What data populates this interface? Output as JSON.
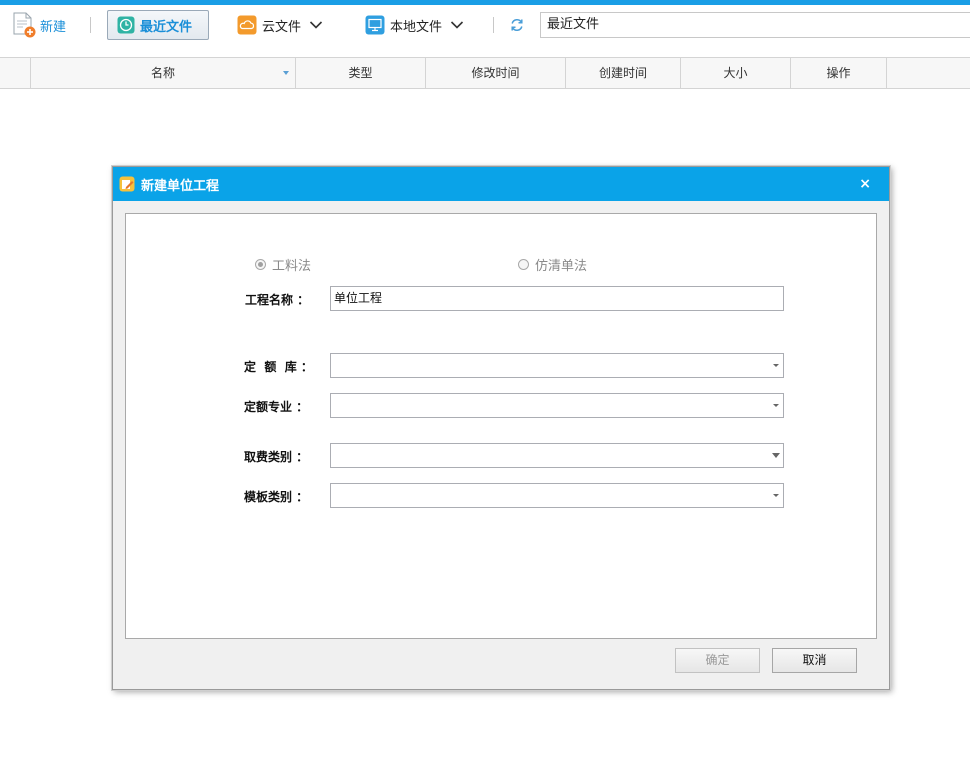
{
  "toolbar": {
    "new_label": "新建",
    "recent_label": "最近文件",
    "cloud_label": "云文件",
    "local_label": "本地文件",
    "path_value": "最近文件"
  },
  "columns": [
    "名称",
    "类型",
    "修改时间",
    "创建时间",
    "大小",
    "操作"
  ],
  "dialog": {
    "title": "新建单位工程",
    "close_glyph": "×",
    "radio_gongliao": "工料法",
    "radio_fangqing": "仿清单法",
    "selected_method": "工料法",
    "fields": [
      {
        "label": "工程名称 ：",
        "value": "单位工程"
      },
      {
        "label": "定  额  库 ：",
        "value": ""
      },
      {
        "label": "定额专业 ：",
        "value": ""
      },
      {
        "label": "取费类别 ：",
        "value": ""
      },
      {
        "label": "模板类别 ：",
        "value": ""
      }
    ],
    "ok_label": "确定",
    "cancel_label": "取消"
  },
  "colors": {
    "accent": "#1a9ee6",
    "title_bar": "#0aa3e8"
  }
}
